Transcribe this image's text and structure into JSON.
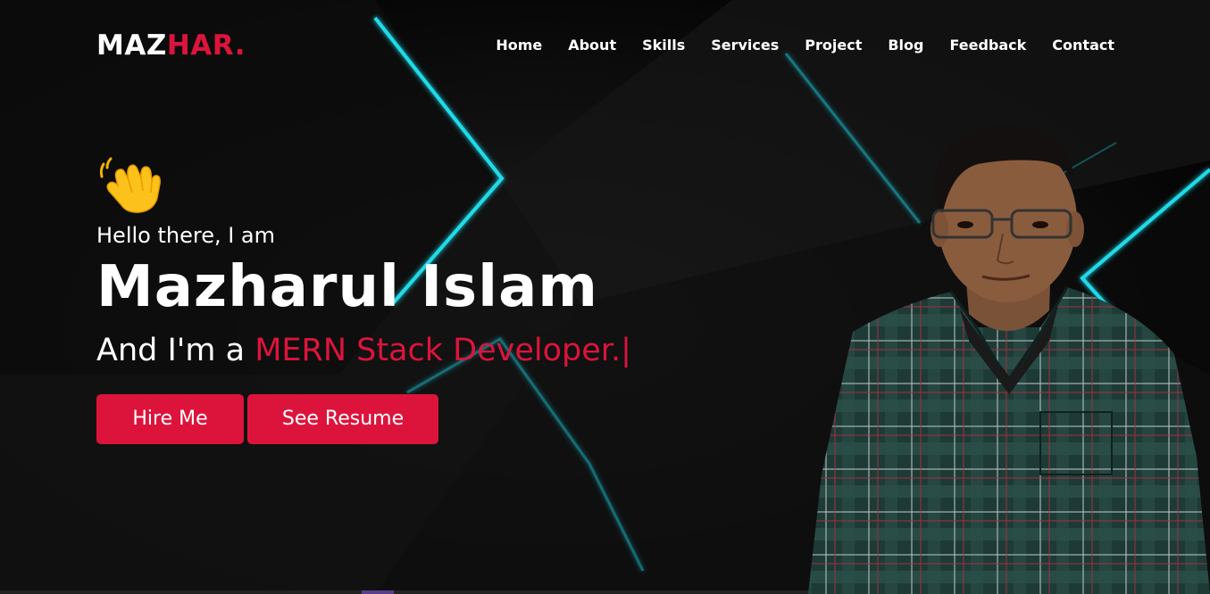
{
  "brand": {
    "logo_primary": "MAZ",
    "logo_accent": "HAR."
  },
  "nav": {
    "items": [
      "Home",
      "About",
      "Skills",
      "Services",
      "Project",
      "Blog",
      "Feedback",
      "Contact"
    ]
  },
  "hero": {
    "wave_icon": "waving-hand-icon",
    "greeting": "Hello there, I am",
    "name": "Mazharul Islam",
    "role_prefix": "And I'm a ",
    "role": "MERN Stack Developer.",
    "cursor": "|",
    "hire_label": "Hire Me",
    "resume_label": "See Resume"
  },
  "colors": {
    "accent": "#dc143c",
    "background": "#0a0a0a",
    "neon": "#22e6f5"
  }
}
